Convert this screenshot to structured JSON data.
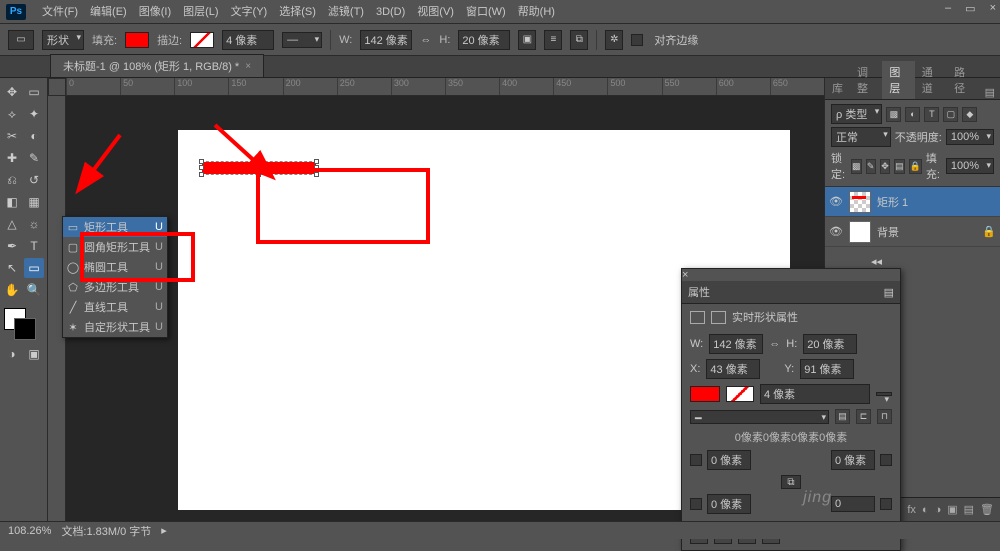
{
  "app": {
    "logo": "Ps"
  },
  "menu": [
    "文件(F)",
    "编辑(E)",
    "图像(I)",
    "图层(L)",
    "文字(Y)",
    "选择(S)",
    "滤镜(T)",
    "3D(D)",
    "视图(V)",
    "窗口(W)",
    "帮助(H)"
  ],
  "options": {
    "mode_label": "形状",
    "fill_label": "填充:",
    "fill_color": "#ff0000",
    "stroke_label": "描边:",
    "stroke_value": "4 像素",
    "w_label": "W:",
    "w_value": "142 像素",
    "h_label": "H:",
    "h_value": "20 像素",
    "align_edges_label": "对齐边缘"
  },
  "doc_tab": {
    "title": "未标题-1 @ 108% (矩形 1, RGB/8) *"
  },
  "ruler_ticks": [
    "0",
    "50",
    "100",
    "150",
    "200",
    "250",
    "300",
    "350",
    "400",
    "450",
    "500",
    "550",
    "600",
    "650"
  ],
  "shape_menu": {
    "items": [
      {
        "icon": "▭",
        "label": "矩形工具",
        "shortcut": "U"
      },
      {
        "icon": "▢",
        "label": "圆角矩形工具",
        "shortcut": "U"
      },
      {
        "icon": "◯",
        "label": "椭圆工具",
        "shortcut": "U"
      },
      {
        "icon": "⬠",
        "label": "多边形工具",
        "shortcut": "U"
      },
      {
        "icon": "╱",
        "label": "直线工具",
        "shortcut": "U"
      },
      {
        "icon": "✶",
        "label": "自定形状工具",
        "shortcut": "U"
      }
    ]
  },
  "layer_panel": {
    "tabs": [
      "库",
      "调整",
      "图层",
      "通道",
      "路径"
    ],
    "active_tab": 2,
    "filter_label": "ρ 类型",
    "blend_mode": "正常",
    "opacity_label": "不透明度:",
    "opacity_value": "100%",
    "lock_label": "锁定:",
    "fill_label": "填充:",
    "fill_value": "100%",
    "layers": [
      {
        "name": "矩形 1",
        "selected": true,
        "thumb": "shape"
      },
      {
        "name": "背景",
        "selected": false,
        "locked": true,
        "thumb": "white"
      }
    ]
  },
  "properties": {
    "tab": "属性",
    "title": "实时形状属性",
    "w_label": "W:",
    "w_value": "142 像素",
    "h_label": "H:",
    "h_value": "20 像素",
    "x_label": "X:",
    "x_value": "43 像素",
    "y_label": "Y:",
    "y_value": "91 像素",
    "stroke_value": "4 像素",
    "corners_text": "0像素0像素0像素0像素",
    "corner_tl": "0 像素",
    "corner_tr": "0 像素",
    "corner_bl": "0 像素",
    "corner_br": "0"
  },
  "status": {
    "zoom": "108.26%",
    "doc_info": "文档:1.83M/0 字节"
  },
  "watermark": "jing"
}
